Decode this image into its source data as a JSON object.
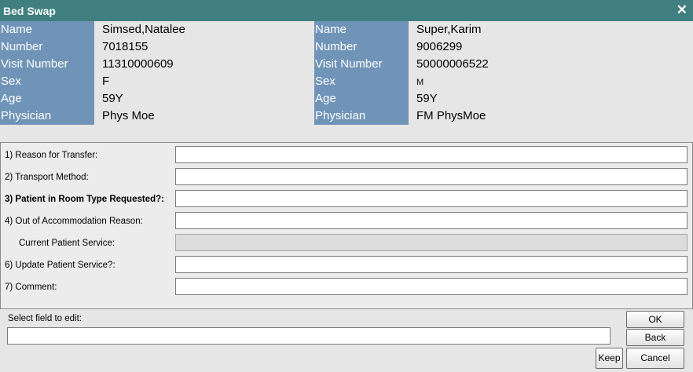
{
  "window": {
    "title": "Bed Swap",
    "close_icon": "close-icon"
  },
  "patient_left": {
    "labels": [
      "Name",
      "Number",
      "Visit Number",
      "Sex",
      "Age",
      "Physician"
    ],
    "values": [
      "Simsed,Natalee",
      "7018155",
      "11310000609",
      "F",
      "59Y",
      "Phys Moe"
    ]
  },
  "patient_right": {
    "labels": [
      "Name",
      "Number",
      "Visit Number",
      "Sex",
      "Age",
      "Physician"
    ],
    "values": [
      "Super,Karim",
      "9006299",
      "50000006522",
      "M",
      "59Y",
      "FM PhysMoe"
    ]
  },
  "form": {
    "fields": [
      {
        "label": "1)  Reason for Transfer:",
        "value": ""
      },
      {
        "label": "2)  Transport Method:",
        "value": ""
      },
      {
        "label": "3)  Patient in Room Type Requested?:",
        "value": ""
      },
      {
        "label": "4)  Out of Accommodation Reason:",
        "value": ""
      },
      {
        "label": "Current Patient Service:",
        "value": ""
      },
      {
        "label": "6)  Update Patient Service?:",
        "value": ""
      },
      {
        "label": "7)  Comment:",
        "value": ""
      }
    ]
  },
  "select": {
    "label": "Select field to edit:",
    "value": ""
  },
  "buttons": {
    "ok": "OK",
    "back": "Back",
    "keep": "Keep",
    "cancel": "Cancel"
  }
}
